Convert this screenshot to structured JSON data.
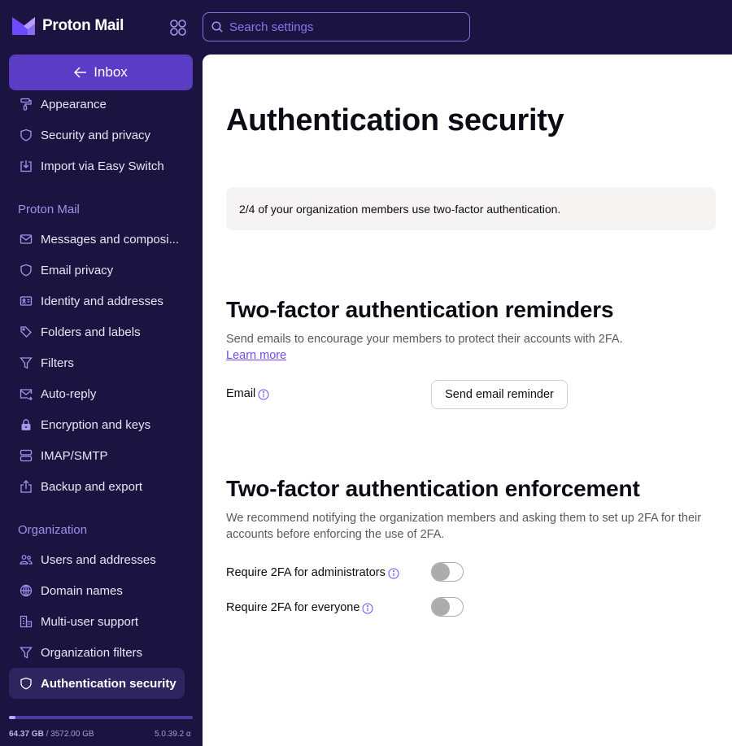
{
  "app": {
    "name": "Proton Mail"
  },
  "header": {
    "search_placeholder": "Search settings",
    "apps_icon": "grid-icon"
  },
  "sidebar": {
    "inbox_label": "Inbox",
    "general_items": [
      {
        "label": "Appearance",
        "icon": "paint-roller-icon"
      },
      {
        "label": "Security and privacy",
        "icon": "shield-icon"
      },
      {
        "label": "Import via Easy Switch",
        "icon": "import-icon"
      }
    ],
    "mail_section_title": "Proton Mail",
    "mail_items": [
      {
        "label": "Messages and composi...",
        "icon": "envelope-icon"
      },
      {
        "label": "Email privacy",
        "icon": "shield-icon"
      },
      {
        "label": "Identity and addresses",
        "icon": "id-card-icon"
      },
      {
        "label": "Folders and labels",
        "icon": "tags-icon"
      },
      {
        "label": "Filters",
        "icon": "filter-icon"
      },
      {
        "label": "Auto-reply",
        "icon": "envelope-reply-icon"
      },
      {
        "label": "Encryption and keys",
        "icon": "lock-icon"
      },
      {
        "label": "IMAP/SMTP",
        "icon": "servers-icon"
      },
      {
        "label": "Backup and export",
        "icon": "export-icon"
      }
    ],
    "org_section_title": "Organization",
    "org_items": [
      {
        "label": "Users and addresses",
        "icon": "users-icon"
      },
      {
        "label": "Domain names",
        "icon": "globe-icon"
      },
      {
        "label": "Multi-user support",
        "icon": "buildings-icon"
      },
      {
        "label": "Organization filters",
        "icon": "filter-icon"
      },
      {
        "label": "Authentication security",
        "icon": "shield-icon",
        "active": true
      }
    ],
    "storage": {
      "used": "64.37 GB",
      "total": "/ 3572.00 GB",
      "used_fraction": 0.018
    },
    "version": "5.0.39.2 α"
  },
  "main": {
    "title": "Authentication security",
    "notice": "2/4 of your organization members use two-factor authentication.",
    "reminders": {
      "heading": "Two-factor authentication reminders",
      "description": "Send emails to encourage your members to protect their accounts with 2FA.",
      "learn_more": "Learn more",
      "email_label": "Email",
      "send_button": "Send email reminder"
    },
    "enforcement": {
      "heading": "Two-factor authentication enforcement",
      "description": "We recommend notifying the organization members and asking them to set up 2FA for their accounts before enforcing the use of 2FA.",
      "admins_label": "Require 2FA for administrators",
      "admins_enabled": false,
      "everyone_label": "Require 2FA for everyone",
      "everyone_enabled": false
    }
  },
  "colors": {
    "sidebar_bg": "#1c1440",
    "accent": "#6d4aff",
    "inbox_button": "#5b3cc4",
    "active_item": "#2e2460"
  }
}
